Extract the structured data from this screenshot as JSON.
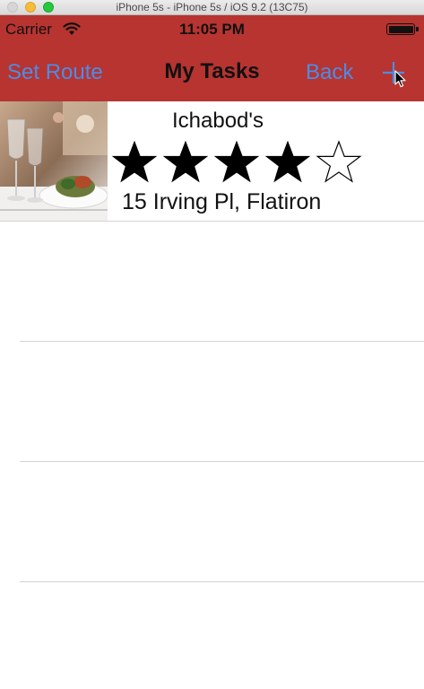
{
  "window": {
    "title": "iPhone 5s - iPhone 5s / iOS 9.2 (13C75)"
  },
  "status_bar": {
    "carrier": "Carrier",
    "time": "11:05 PM",
    "wifi_icon": "wifi-icon",
    "battery_icon": "battery-icon",
    "battery_level": 1.0
  },
  "nav": {
    "left_label": "Set Route",
    "title": "My Tasks",
    "back_label": "Back",
    "add_icon": "plus-icon"
  },
  "colors": {
    "header_background": "#b73430",
    "link": "#4a8de8",
    "divider": "#d4d4d4"
  },
  "tasks": [
    {
      "name": "Ichabod's",
      "rating": 4,
      "max_rating": 5,
      "address": "15 Irving Pl, Flatiron",
      "thumbnail_icon": "restaurant-table-photo"
    }
  ],
  "empty_rows": 3
}
